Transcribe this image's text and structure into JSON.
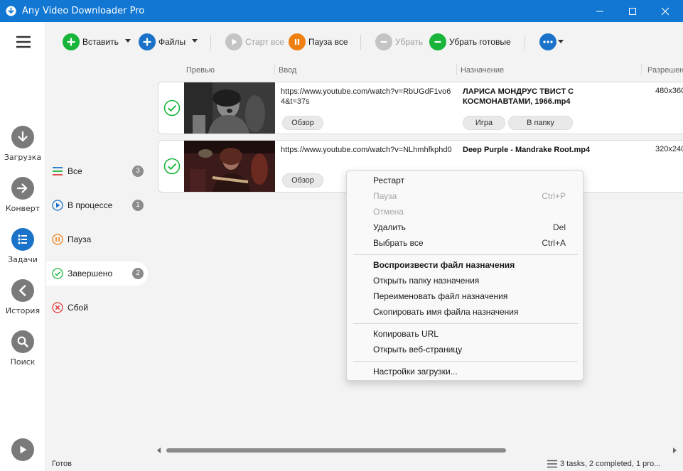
{
  "window": {
    "title": "Any Video Downloader Pro"
  },
  "toolbar": {
    "paste_label": "Вставить",
    "files_label": "Файлы",
    "start_all_label": "Старт все",
    "pause_all_label": "Пауза все",
    "remove_label": "Убрать",
    "remove_done_label": "Убрать готовые"
  },
  "rail": {
    "items": [
      {
        "label": "Загрузка",
        "icon": "download-icon"
      },
      {
        "label": "Конверт",
        "icon": "convert-icon"
      },
      {
        "label": "Задачи",
        "icon": "tasks-icon"
      },
      {
        "label": "История",
        "icon": "history-icon"
      },
      {
        "label": "Поиск",
        "icon": "search-icon"
      }
    ]
  },
  "filters": [
    {
      "label": "Все",
      "count": "3"
    },
    {
      "label": "В процессе",
      "count": "1"
    },
    {
      "label": "Пауза",
      "count": ""
    },
    {
      "label": "Завершено",
      "count": "2"
    },
    {
      "label": "Сбой",
      "count": ""
    }
  ],
  "columns": {
    "preview": "Превью",
    "input": "Ввод",
    "destination": "Назначение",
    "resolution": "Разрешен"
  },
  "tasks": [
    {
      "url": "https://www.youtube.com/watch?v=RbUGdF1vo64&t=37s",
      "destination": "ЛАРИСА МОНДРУС  ТВИСТ С КОСМОНАВТАМИ, 1966.mp4",
      "resolution": "480x360",
      "browse_label": "Обзор",
      "play_label": "Игра",
      "folder_label": "В папку"
    },
    {
      "url": "https://www.youtube.com/watch?v=NLhmhfkphd0",
      "destination": "Deep Purple - Mandrake Root.mp4",
      "resolution": "320x240",
      "browse_label": "Обзор"
    }
  ],
  "context_menu": {
    "items": [
      {
        "label": "Рестарт",
        "shortcut": ""
      },
      {
        "label": "Пауза",
        "shortcut": "Ctrl+P"
      },
      {
        "label": "Отмена",
        "shortcut": ""
      },
      {
        "label": "Удалить",
        "shortcut": "Del"
      },
      {
        "label": "Выбрать все",
        "shortcut": "Ctrl+A"
      },
      {
        "label": "Воспроизвести файл назначения",
        "shortcut": ""
      },
      {
        "label": "Открыть папку назначения",
        "shortcut": ""
      },
      {
        "label": "Переименовать файл назначения",
        "shortcut": ""
      },
      {
        "label": "Скопировать имя файла назначения",
        "shortcut": ""
      },
      {
        "label": "Копировать URL",
        "shortcut": ""
      },
      {
        "label": "Открыть веб-страницу",
        "shortcut": ""
      },
      {
        "label": "Настройки загрузки...",
        "shortcut": ""
      }
    ]
  },
  "status": {
    "left": "Готов",
    "right": "3 tasks, 2 completed, 1 pro..."
  },
  "colors": {
    "titlebar": "#1177d2",
    "accent_blue": "#1a73c8",
    "green": "#18b53a",
    "orange": "#f07f12",
    "disabled": "#bdbdbd"
  }
}
